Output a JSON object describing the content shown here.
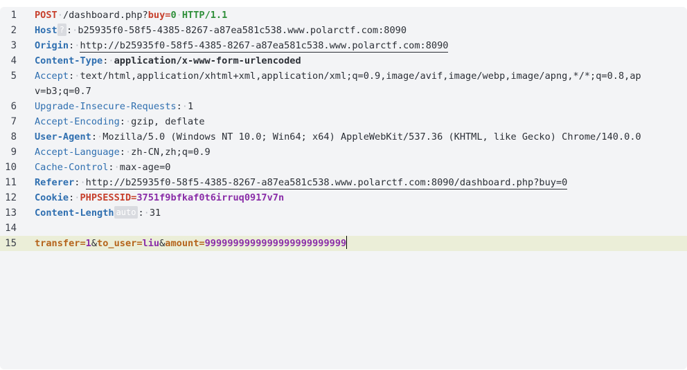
{
  "request": {
    "line1": {
      "method": "POST",
      "path": "/dashboard.php?",
      "query_key": "buy",
      "eq": "=",
      "query_val": "0",
      "protocol": "HTTP/1.1"
    },
    "host": {
      "name": "Host",
      "badge": "?",
      "value": "b25935f0-58f5-4385-8267-a87ea581c538.www.polarctf.com:8090"
    },
    "origin": {
      "name": "Origin",
      "value": "http://b25935f0-58f5-4385-8267-a87ea581c538.www.polarctf.com:8090"
    },
    "content_type": {
      "name": "Content-Type",
      "value": "application/x-www-form-urlencoded"
    },
    "accept": {
      "name": "Accept",
      "value": "text/html,application/xhtml+xml,application/xml;q=0.9,image/avif,image/webp,image/apng,*/*;q=0.8,ap",
      "continuation": "v=b3;q=0.7"
    },
    "upgrade": {
      "name": "Upgrade-Insecure-Requests",
      "value": "1"
    },
    "accept_encoding": {
      "name": "Accept-Encoding",
      "value": "gzip, deflate"
    },
    "user_agent": {
      "name": "User-Agent",
      "value": "Mozilla/5.0 (Windows NT 10.0; Win64; x64) AppleWebKit/537.36 (KHTML, like Gecko) Chrome/140.0.0"
    },
    "accept_language": {
      "name": "Accept-Language",
      "value": "zh-CN,zh;q=0.9"
    },
    "cache_control": {
      "name": "Cache-Control",
      "value": "max-age=0"
    },
    "referer": {
      "name": "Referer",
      "value": "http://b25935f0-58f5-4385-8267-a87ea581c538.www.polarctf.com:8090/dashboard.php?buy=0"
    },
    "cookie": {
      "name": "Cookie",
      "key": "PHPSESSID",
      "eq": "=",
      "value": "3751f9bfkaf0t6irruq0917v7n"
    },
    "content_length": {
      "name": "Content-Length",
      "badge": "auto",
      "value": "31"
    },
    "body": {
      "k1": "transfer",
      "v1": "1",
      "k2": "to_user",
      "v2": "liu",
      "k3": "amount",
      "v3": "9999999999999999999999999",
      "eq": "=",
      "amp": "&"
    }
  },
  "line_numbers": [
    "1",
    "2",
    "3",
    "4",
    "5",
    "6",
    "7",
    "8",
    "9",
    "10",
    "11",
    "12",
    "13",
    "14",
    "15"
  ],
  "colon": ":",
  "colors": {
    "editor_bg": "#f3f4f6",
    "active_line": "#ebeed8",
    "method": "#c7402d",
    "header_name": "#2f6fb0",
    "protocol": "#2f8f3a",
    "cookie_value": "#8a2da8",
    "body_key": "#b5651d"
  }
}
